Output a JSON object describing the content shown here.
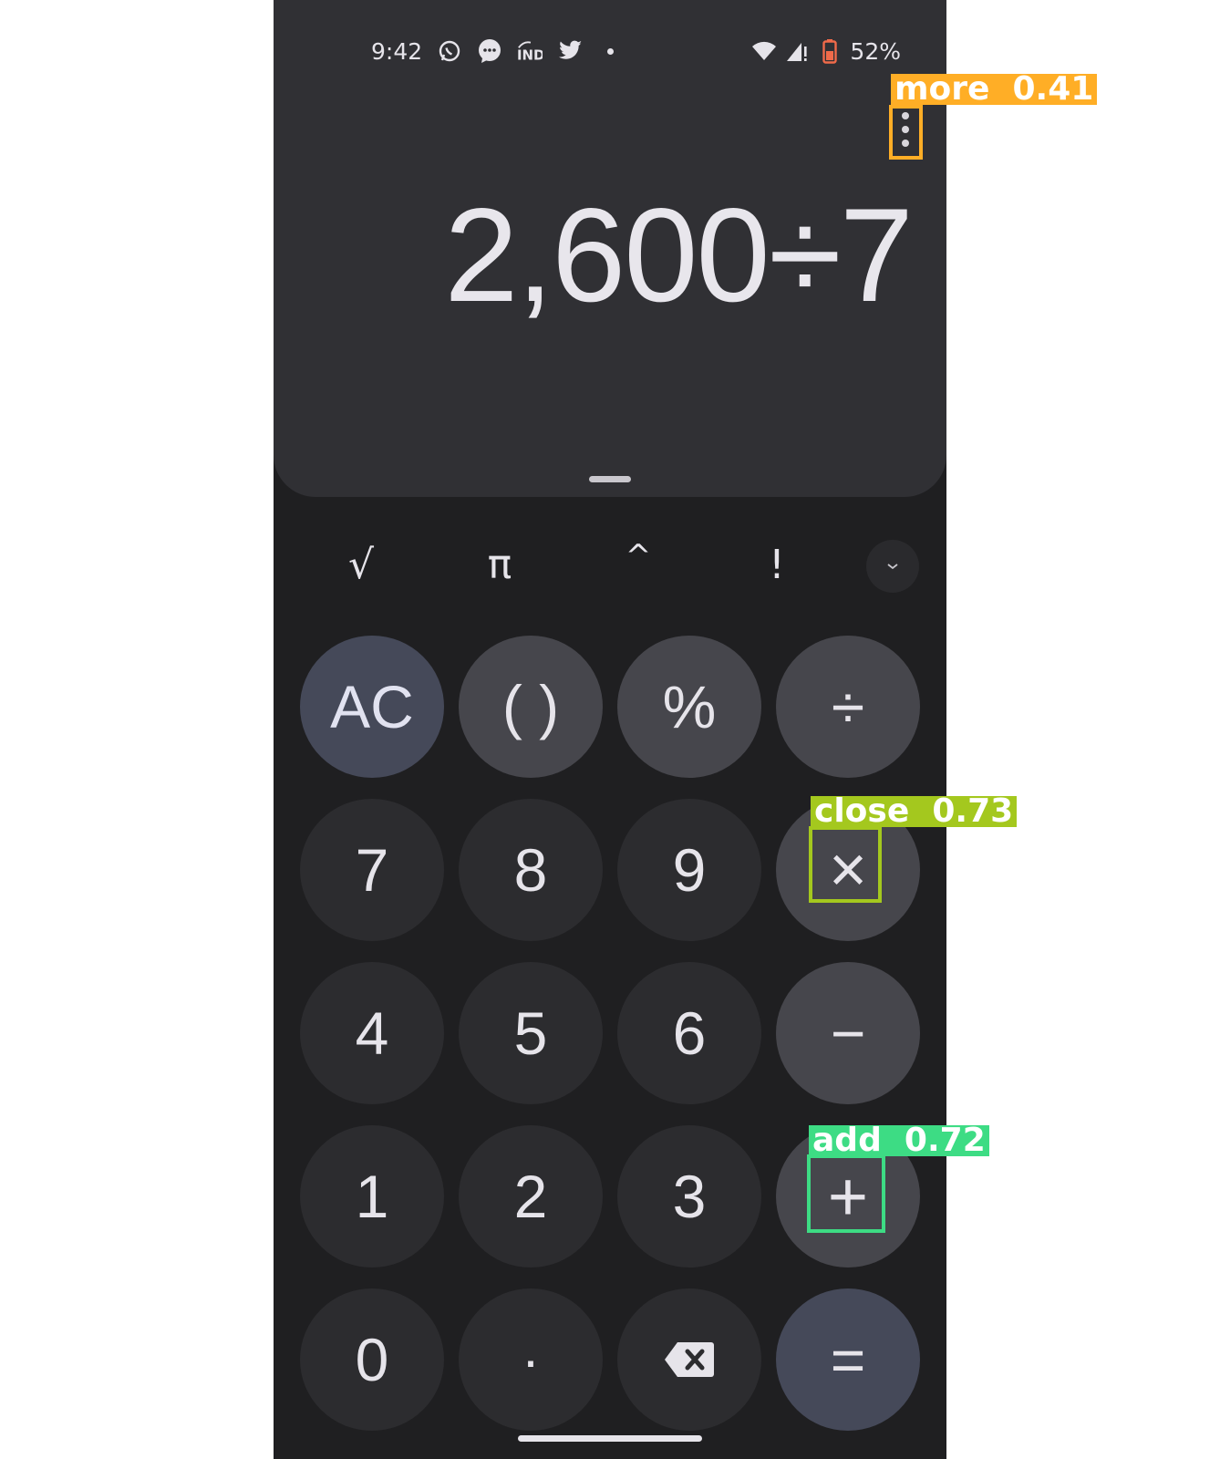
{
  "status_bar": {
    "time": "9:42",
    "left_icons": [
      "whatsapp-icon",
      "messages-icon",
      "indeed-icon",
      "twitter-icon",
      "notification-dot-icon"
    ],
    "right_icons": [
      "wifi-icon",
      "cell-signal-icon",
      "battery-icon"
    ],
    "battery_percent": "52%"
  },
  "display": {
    "expression": "2,600÷7",
    "more_icon": "more-vert-icon"
  },
  "scientific_row": {
    "keys": [
      "√",
      "π",
      "^",
      "!"
    ],
    "expand_icon": "chevron-down-icon"
  },
  "keypad": {
    "row1": [
      "AC",
      "( )",
      "%",
      "÷"
    ],
    "row2": [
      "7",
      "8",
      "9",
      "×"
    ],
    "row3": [
      "4",
      "5",
      "6",
      "−"
    ],
    "row4": [
      "1",
      "2",
      "3",
      "+"
    ],
    "row5": [
      "0",
      "·",
      "backspace-icon",
      "="
    ]
  },
  "detections": [
    {
      "label": "more",
      "score": "0.41",
      "color": "#ffae26"
    },
    {
      "label": "close",
      "score": "0.73",
      "color": "#a4c81e"
    },
    {
      "label": "add",
      "score": "0.72",
      "color": "#3ddc84"
    }
  ]
}
